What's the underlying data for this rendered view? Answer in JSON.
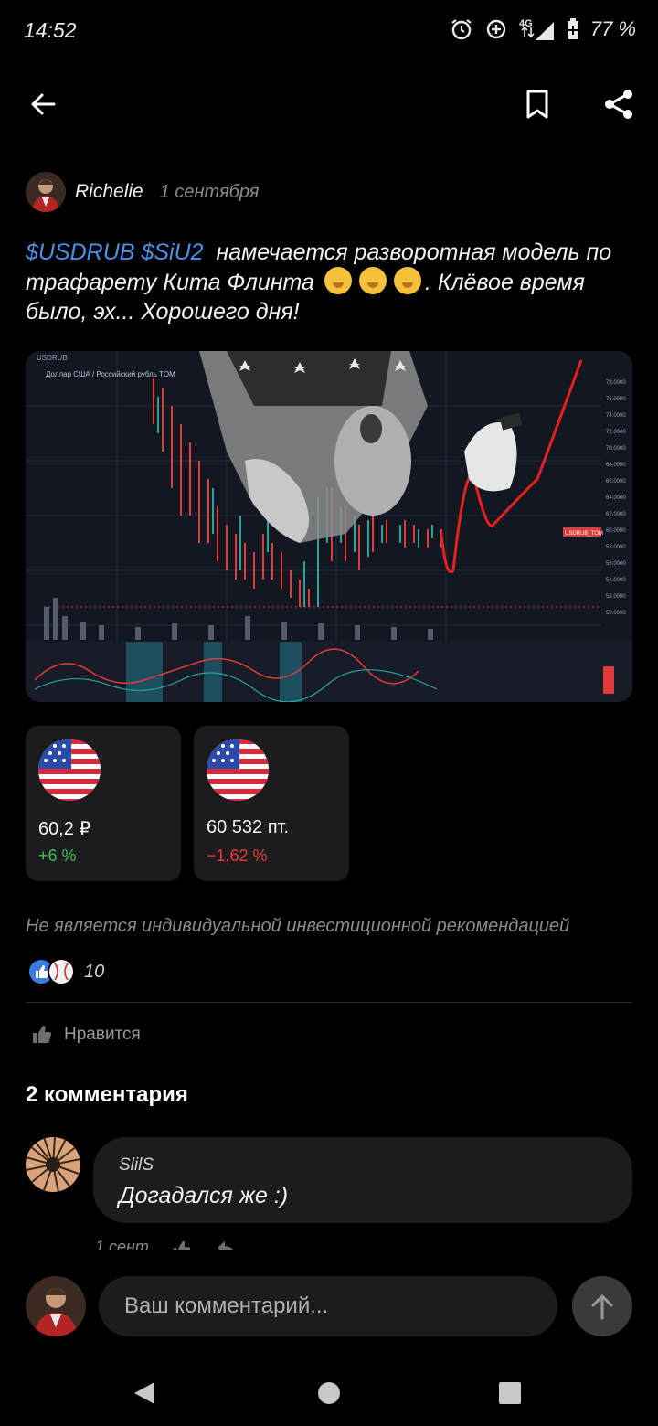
{
  "status": {
    "time": "14:52",
    "network": "4G",
    "battery": "77 %"
  },
  "topbar": {
    "back_icon": "arrow-left-icon",
    "bookmark_icon": "bookmark-icon",
    "share_icon": "share-icon"
  },
  "post": {
    "author": "Richelie",
    "date": "1 сентября",
    "tag1": "$USDRUB",
    "tag2": "$SiU2",
    "text_main": "намечается разворотная модель по трафарету Кита Флинта",
    "text_end": ". Клёвое время было, эх... Хорошего дня!",
    "emoji_name": "face-with-hand-over-mouth-emoji"
  },
  "chart_image": {
    "ticker_label": "USDRUB",
    "subtitle": "Доллар США / Российский рубль TOM",
    "price_label": "USDRUB_TOM",
    "axis_labels": [
      "78.0000",
      "76.0000",
      "74.0000",
      "72.0000",
      "70.0000",
      "68.0000",
      "66.0000",
      "64.0000",
      "62.0000",
      "60.0000",
      "58.0000",
      "56.0000",
      "54.0000",
      "52.0000",
      "50.0000"
    ]
  },
  "tickers": [
    {
      "price": "60,2  ₽",
      "change": "+6 %",
      "change_color": "#3ec25a"
    },
    {
      "price": "60 532   пт.",
      "change": "−1,62 %",
      "change_color": "#ec3b3b"
    }
  ],
  "disclaimer": "Не является индивидуальной инвестиционной рекомендацией",
  "reactions": {
    "count": "10"
  },
  "like": {
    "label": "Нравится"
  },
  "comments": {
    "title": "2 комментария",
    "items": [
      {
        "author": "SlilS",
        "text": "Догадался же :)",
        "date": "1 сент."
      }
    ]
  },
  "input": {
    "placeholder": "Ваш комментарий..."
  },
  "colors": {
    "accent": "#4a8fe8",
    "positive": "#3ec25a",
    "negative": "#ec3b3b",
    "card": "#1c1c1e"
  }
}
